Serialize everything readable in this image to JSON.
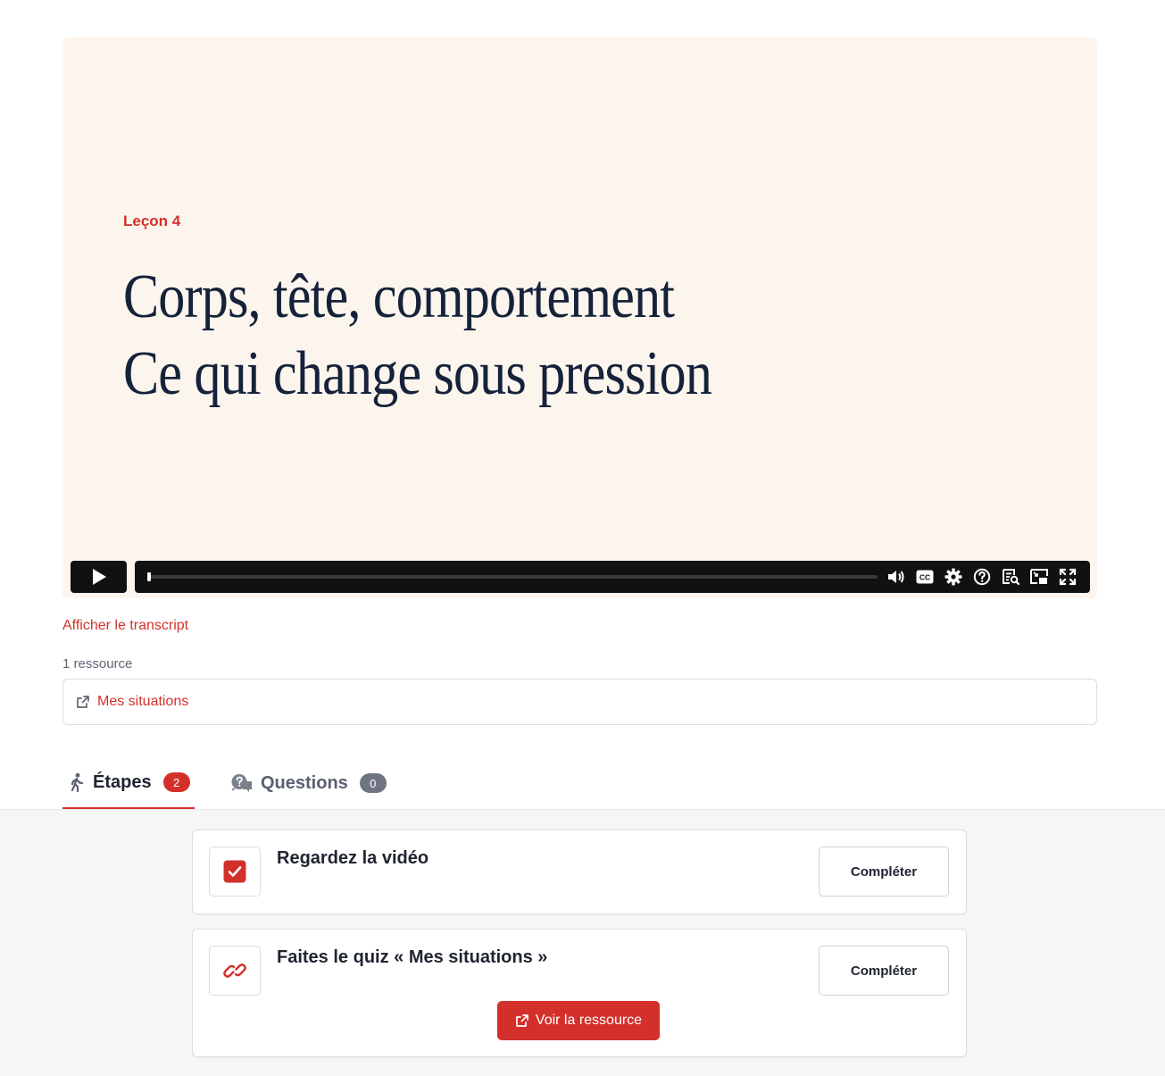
{
  "video": {
    "lesson_label": "Leçon 4",
    "title_line1": "Corps, tête, comportement",
    "title_line2": "Ce qui change sous pression",
    "progress_fraction": 0.003,
    "controls": [
      "play-icon",
      "volume-icon",
      "closed-captions-icon",
      "settings-icon",
      "help-icon",
      "transcript-icon",
      "picture-in-picture-icon",
      "fullscreen-icon"
    ],
    "cc_label": "CC"
  },
  "transcript_link": "Afficher le transcript",
  "resources": {
    "count_label": "1 ressource",
    "items": [
      {
        "label": "Mes situations",
        "icon": "external-link-icon"
      }
    ]
  },
  "tabs": [
    {
      "label": "Étapes",
      "count": "2",
      "icon": "walking-person-icon",
      "active": true
    },
    {
      "label": "Questions",
      "count": "0",
      "icon": "question-bubbles-icon",
      "active": false
    }
  ],
  "steps": [
    {
      "title": "Regardez la vidéo",
      "icon": "checkbox-checked-icon",
      "button": "Compléter"
    },
    {
      "title": "Faites le quiz « Mes situations »",
      "icon": "link-icon",
      "button": "Compléter",
      "secondary_button": "Voir la ressource"
    }
  ],
  "colors": {
    "accent": "#d4302b",
    "video_bg": "#fcf5ee",
    "title_text": "#15223a",
    "panel_bg": "#f6f6f6"
  }
}
